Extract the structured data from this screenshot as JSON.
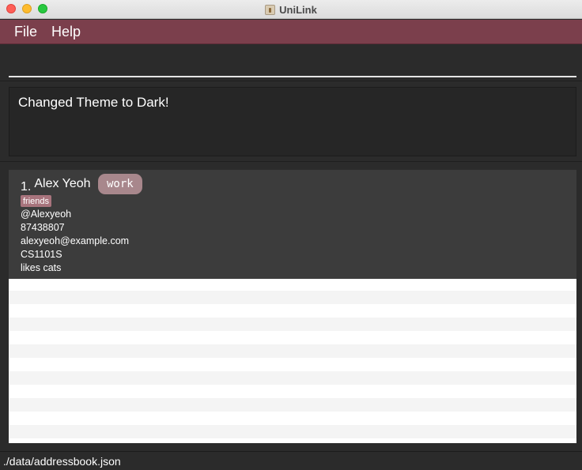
{
  "window": {
    "title": "UniLink",
    "app_icon": "app-icon"
  },
  "menu": {
    "items": [
      {
        "label": "File"
      },
      {
        "label": "Help"
      }
    ]
  },
  "command": {
    "value": "",
    "placeholder": ""
  },
  "result": {
    "message": "Changed Theme to Dark!"
  },
  "persons": [
    {
      "index": "1.",
      "name": "Alex Yeoh",
      "tags": [
        "work",
        "friends"
      ],
      "telegram": "@Alexyeoh",
      "phone": "87438807",
      "email": "alexyeoh@example.com",
      "module": "CS1101S",
      "remark": "likes cats"
    }
  ],
  "status": {
    "path": "./data/addressbook.json"
  },
  "colors": {
    "menu_bar": "#7b3f4c",
    "background": "#2b2b2b",
    "card": "#3c3c3c",
    "work_tag": "#a8878c",
    "friends_tag": "#a8747d"
  }
}
